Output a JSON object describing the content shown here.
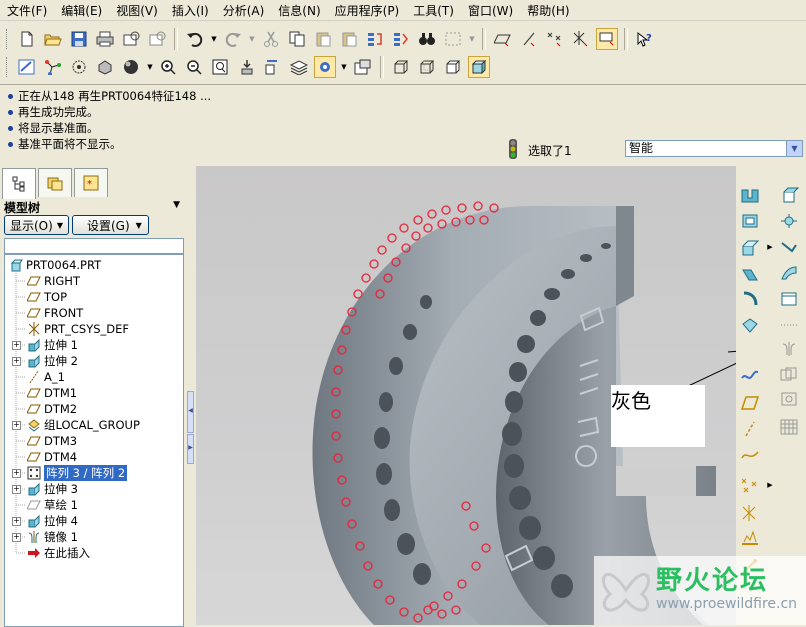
{
  "menu": [
    "文件(F)",
    "编辑(E)",
    "视图(V)",
    "插入(I)",
    "分析(A)",
    "信息(N)",
    "应用程序(P)",
    "工具(T)",
    "窗口(W)",
    "帮助(H)"
  ],
  "messages": [
    "正在从148 再生PRT0064特征148 ...",
    "再生成功完成。",
    "将显示基准面。",
    "基准平面将不显示。"
  ],
  "selection": {
    "text": "选取了1",
    "filter": "智能"
  },
  "model_tree": {
    "title": "模型树",
    "show_label": "显示(O)",
    "settings_label": "设置(G)",
    "items": [
      {
        "label": "PRT0064.PRT",
        "icon": "part-icon",
        "expandable": false,
        "selected": false
      },
      {
        "label": "RIGHT",
        "icon": "datum-plane-icon",
        "expandable": false,
        "selected": false
      },
      {
        "label": "TOP",
        "icon": "datum-plane-icon",
        "expandable": false,
        "selected": false
      },
      {
        "label": "FRONT",
        "icon": "datum-plane-icon",
        "expandable": false,
        "selected": false
      },
      {
        "label": "PRT_CSYS_DEF",
        "icon": "csys-icon",
        "expandable": false,
        "selected": false
      },
      {
        "label": "拉伸 1",
        "icon": "extrude-icon",
        "expandable": true,
        "selected": false
      },
      {
        "label": "拉伸 2",
        "icon": "extrude-icon",
        "expandable": true,
        "selected": false
      },
      {
        "label": "A_1",
        "icon": "datum-axis-icon",
        "expandable": false,
        "selected": false
      },
      {
        "label": "DTM1",
        "icon": "datum-plane-icon",
        "expandable": false,
        "selected": false
      },
      {
        "label": "DTM2",
        "icon": "datum-plane-icon",
        "expandable": false,
        "selected": false
      },
      {
        "label": "组LOCAL_GROUP",
        "icon": "group-icon",
        "expandable": true,
        "selected": false
      },
      {
        "label": "DTM3",
        "icon": "datum-plane-icon",
        "expandable": false,
        "selected": false
      },
      {
        "label": "DTM4",
        "icon": "datum-plane-icon",
        "expandable": false,
        "selected": false
      },
      {
        "label": "阵列 3 / 阵列 2",
        "icon": "pattern-icon",
        "expandable": true,
        "selected": true
      },
      {
        "label": "拉伸 3",
        "icon": "extrude-icon",
        "expandable": true,
        "selected": false
      },
      {
        "label": "草绘 1",
        "icon": "sketch-icon",
        "expandable": false,
        "selected": false
      },
      {
        "label": "拉伸 4",
        "icon": "extrude-icon",
        "expandable": true,
        "selected": false
      },
      {
        "label": "镜像 1",
        "icon": "mirror-icon",
        "expandable": true,
        "selected": false
      },
      {
        "label": "在此插入",
        "icon": "insert-arrow-icon",
        "expandable": false,
        "selected": false
      }
    ]
  },
  "annotation": {
    "text": "灰色"
  },
  "watermark": {
    "title": "野火论坛",
    "url": "www.proewildfire.cn"
  },
  "colors": {
    "highlight": "#316ac5",
    "pattern_marks": "#e8243a",
    "model_gray": "#9aa2aa",
    "panel": "#ece9d8"
  }
}
